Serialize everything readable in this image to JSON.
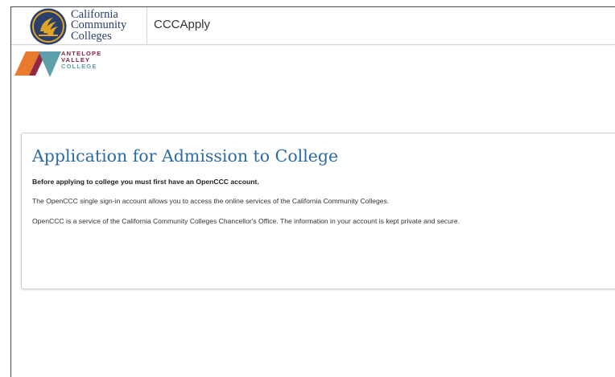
{
  "header": {
    "brand_lines": [
      "California",
      "Community",
      "Colleges"
    ],
    "app_name": "CCCApply"
  },
  "college": {
    "name_lines": [
      "ANTELOPE",
      "VALLEY",
      "COLLEGE"
    ]
  },
  "card": {
    "title": "Application for Admission to College",
    "notice": "Before applying to college you must first have an OpenCCC account.",
    "paragraph_1": "The OpenCCC single sign-in account allows you to access the online services of the California Community Colleges.",
    "paragraph_2": "OpenCCC is a service of the California Community Colleges Chancellor's Office. The information in your account is kept private and secure."
  },
  "colors": {
    "ccc_navy": "#2a3f6b",
    "ccc_gold": "#e0a526",
    "title_blue": "#2c6ba3",
    "avc_orange": "#e97b2f",
    "avc_maroon": "#8e1c3a",
    "avc_teal": "#5f9eab"
  },
  "icons": {
    "ccc_logo": "ccc-seal-icon",
    "avc_logo": "avc-mountain-icon"
  }
}
